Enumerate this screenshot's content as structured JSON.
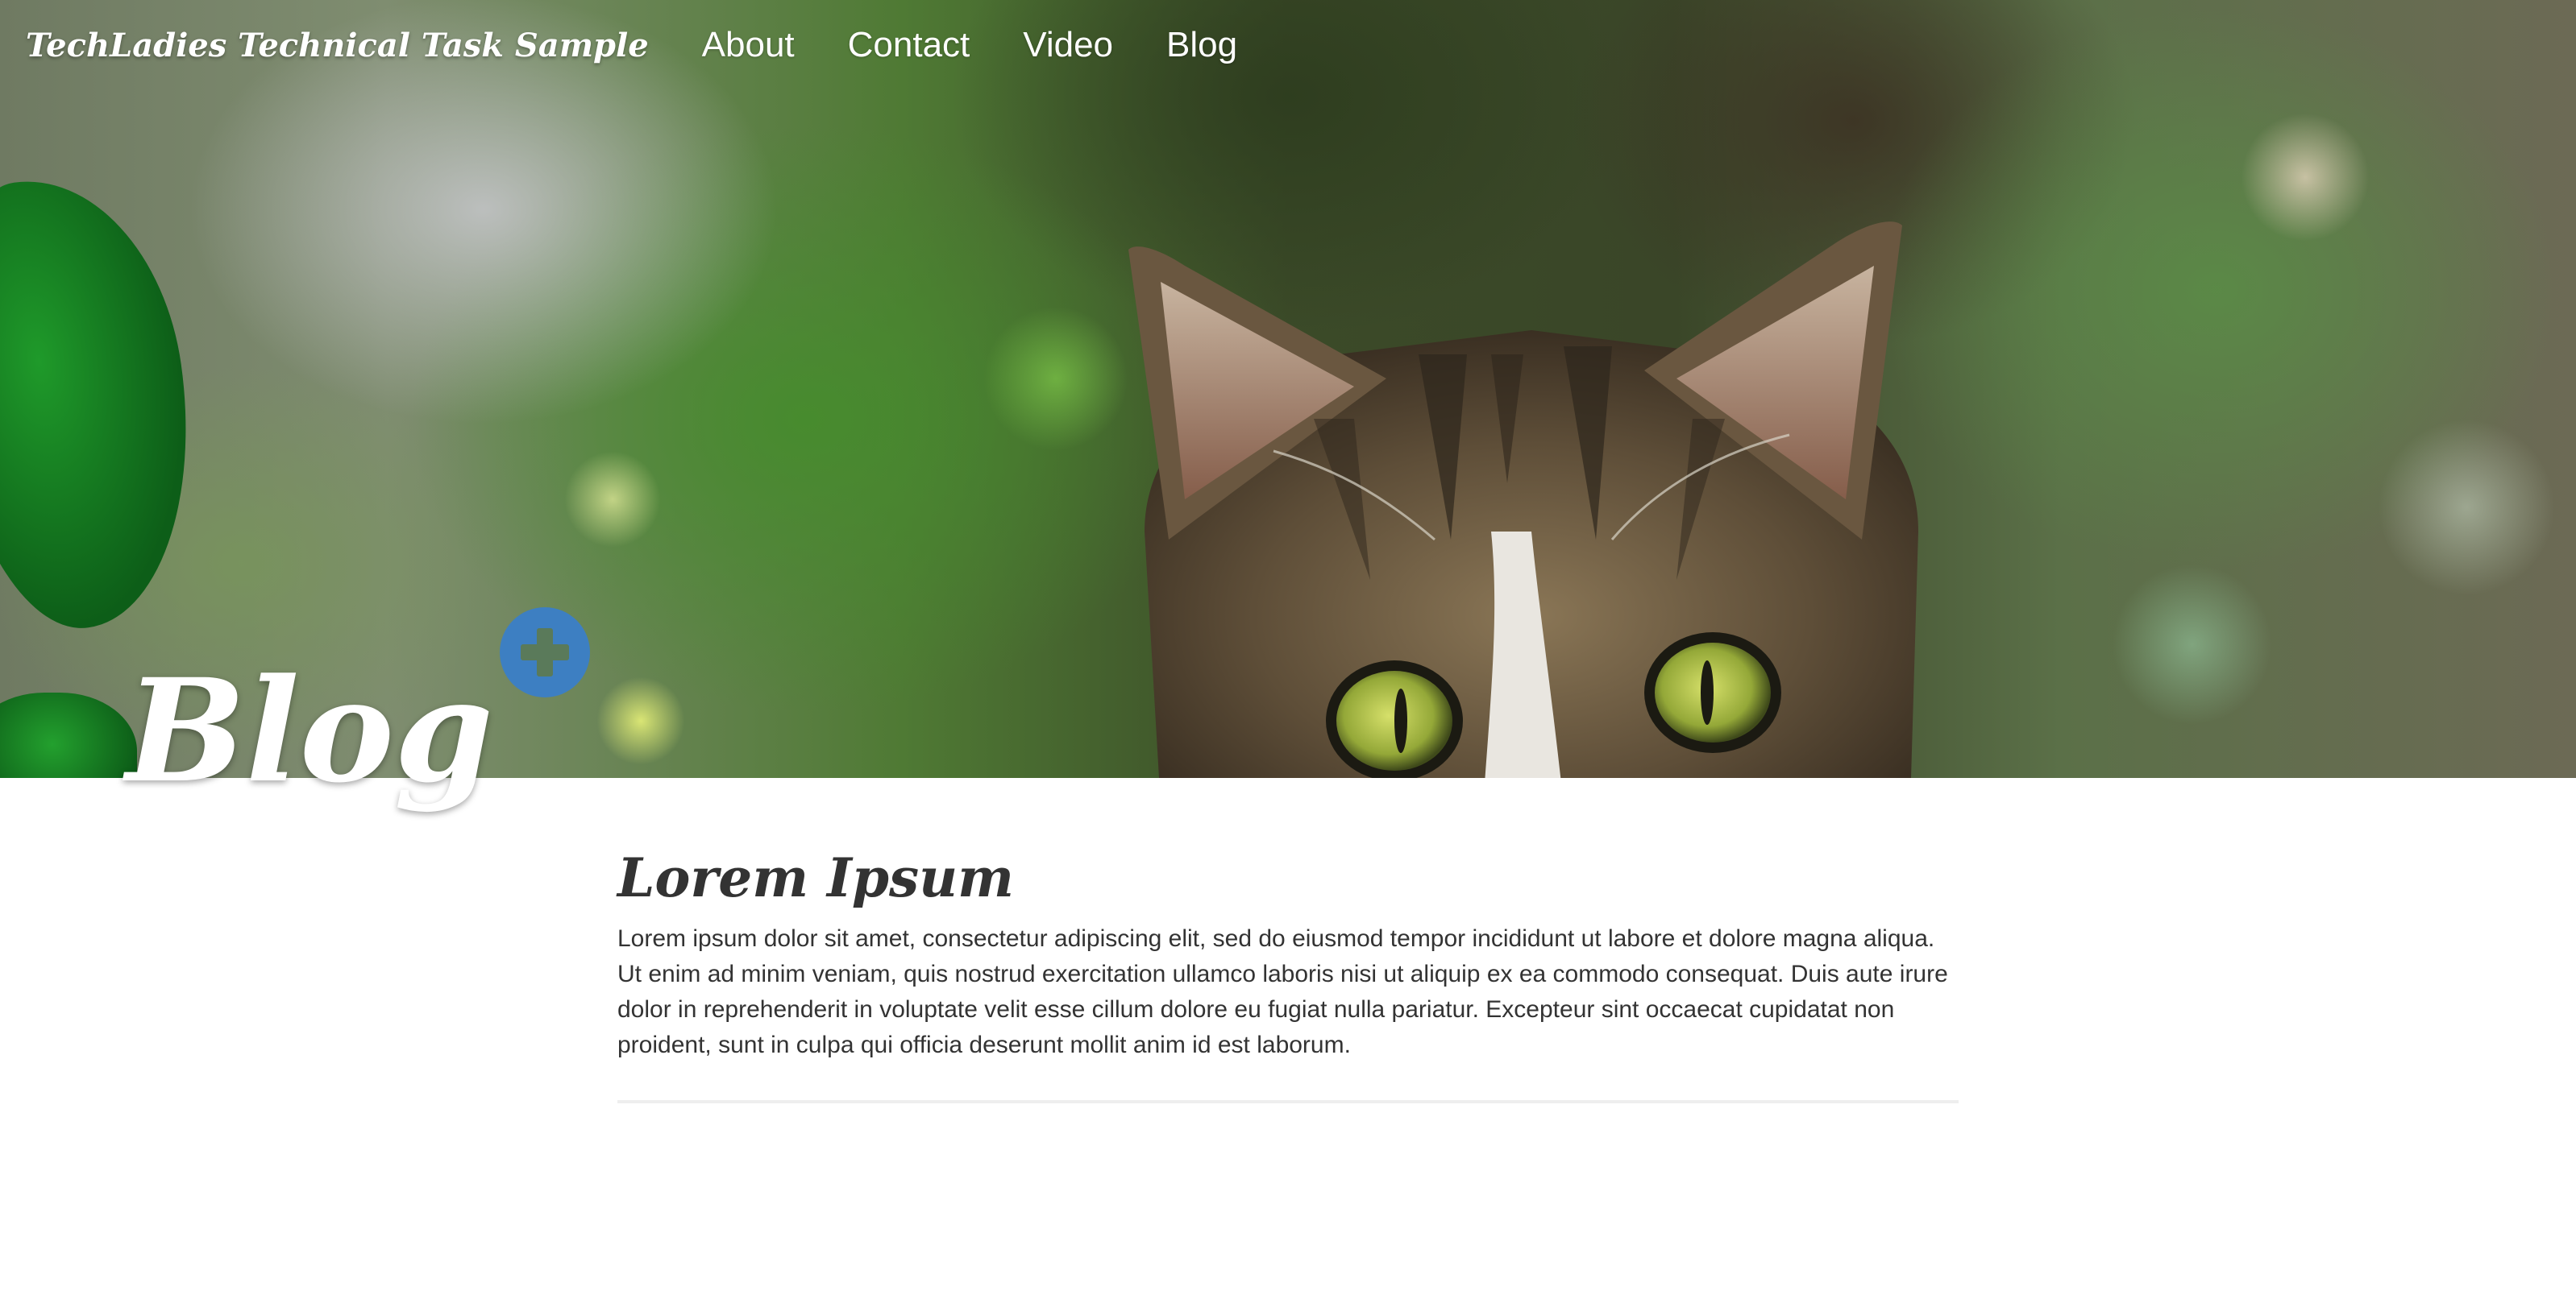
{
  "nav": {
    "brand": "TechLadies Technical Task Sample",
    "links": [
      "About",
      "Contact",
      "Video",
      "Blog"
    ]
  },
  "hero": {
    "title": "Blog",
    "add_icon": "plus-icon",
    "image": "cat-peeking-photo"
  },
  "posts": [
    {
      "title": "Lorem Ipsum",
      "body": "Lorem ipsum dolor sit amet, consectetur adipiscing elit, sed do eiusmod tempor incididunt ut labore et dolore magna aliqua. Ut enim ad minim veniam, quis nostrud exercitation ullamco laboris nisi ut aliquip ex ea commodo consequat. Duis aute irure dolor in reprehenderit in voluptate velit esse cillum dolore eu fugiat nulla pariatur. Excepteur sint occaecat cupidatat non proident, sunt in culpa qui officia deserunt mollit anim id est laborum."
    }
  ],
  "colors": {
    "accent": "#3d7fc2",
    "text": "#333333",
    "divider": "#eeeeee"
  }
}
